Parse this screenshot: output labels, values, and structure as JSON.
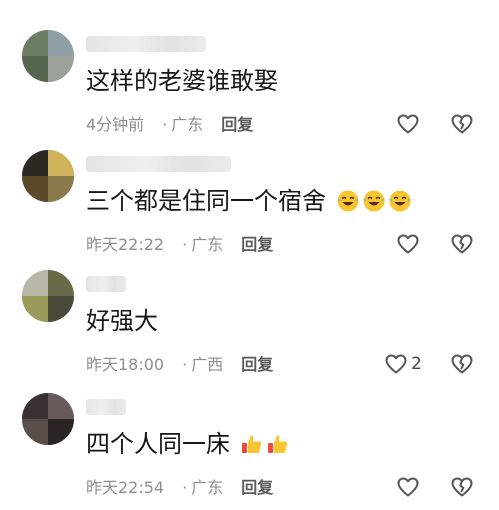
{
  "comments": [
    {
      "text": "这样的老婆谁敢娶",
      "time": "4分钟前",
      "location": "广东",
      "reply_label": "回复",
      "like_count": "",
      "emoji": ""
    },
    {
      "text": "三个都是住同一个宿舍",
      "time": "昨天22:22",
      "location": "广东",
      "reply_label": "回复",
      "like_count": "",
      "emoji": "laughing-crying"
    },
    {
      "text": "好强大",
      "time": "昨天18:00",
      "location": "广西",
      "reply_label": "回复",
      "like_count": "2",
      "emoji": ""
    },
    {
      "text": "四个人同一床",
      "time": "昨天22:54",
      "location": "广东",
      "reply_label": "回复",
      "like_count": "",
      "emoji": "thumbs-up"
    }
  ],
  "colors": {
    "meta_gray": "#8f8f8f",
    "reply_gray": "#5a5a5a",
    "icon_gray": "#555555",
    "emoji_yellow": "#f7c531"
  }
}
